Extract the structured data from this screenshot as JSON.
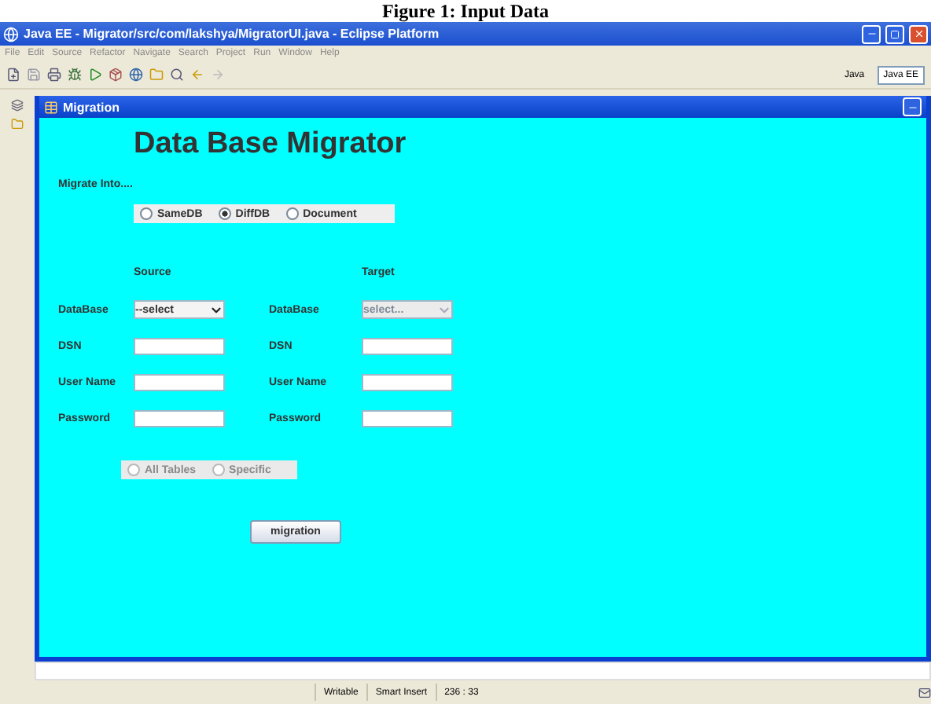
{
  "caption": "Figure 1: Input Data",
  "window": {
    "title": "Java EE - Migrator/src/com/lakshya/MigratorUI.java - Eclipse Platform"
  },
  "menu": [
    "File",
    "Edit",
    "Source",
    "Refactor",
    "Navigate",
    "Search",
    "Project",
    "Run",
    "Window",
    "Help"
  ],
  "perspectives": [
    {
      "label": "Java",
      "selected": false
    },
    {
      "label": "Java EE",
      "selected": true
    }
  ],
  "frame": {
    "title": "Migration",
    "heading": "Data Base Migrator",
    "migrate_label": "Migrate Into....",
    "modes": [
      {
        "label": "SameDB",
        "selected": false
      },
      {
        "label": "DiffDB",
        "selected": true
      },
      {
        "label": "Document",
        "selected": false
      }
    ],
    "source": {
      "heading": "Source",
      "database": {
        "label": "DataBase",
        "value": "--select",
        "disabled": false
      },
      "fields": [
        {
          "label": "DSN"
        },
        {
          "label": "User Name"
        },
        {
          "label": "Password"
        }
      ]
    },
    "target": {
      "heading": "Target",
      "database": {
        "label": "DataBase",
        "value": "select...",
        "disabled": true
      },
      "fields": [
        {
          "label": "DSN"
        },
        {
          "label": "User Name"
        },
        {
          "label": "Password"
        }
      ]
    },
    "scope": {
      "disabled": true,
      "options": [
        {
          "label": "All Tables",
          "selected": false
        },
        {
          "label": "Specific",
          "selected": false
        }
      ]
    },
    "button": "migration"
  },
  "status_bar": [
    "Writable",
    "Smart Insert",
    "236 : 33"
  ]
}
